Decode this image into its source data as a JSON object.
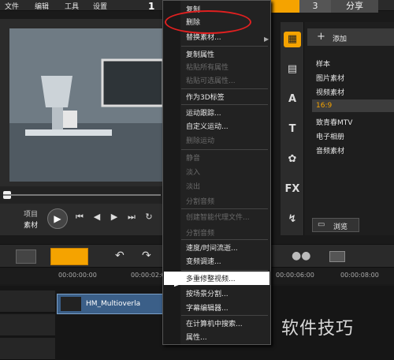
{
  "menubar": {
    "items": [
      "文件",
      "编辑",
      "工具",
      "设置"
    ]
  },
  "steps": {
    "step1": "1",
    "step3": "3",
    "share": "分享"
  },
  "player": {
    "project_label": "项目",
    "clip_label": "素材"
  },
  "library": {
    "add_label": "添加",
    "items": [
      "样本",
      "图片素材",
      "视频素材",
      "16:9",
      "致青春MTV",
      "电子相册",
      "音频素材"
    ],
    "browse_label": "浏览"
  },
  "ruler": {
    "times": [
      "00:00:00:00",
      "00:00:02:00",
      "00:00:06:00",
      "00:00:08:00"
    ]
  },
  "clip": {
    "name": "HM_Multioverla"
  },
  "context_menu": {
    "items": [
      {
        "label": "复制",
        "disabled": false
      },
      {
        "label": "删除",
        "disabled": false
      },
      {
        "label": "替换素材...",
        "disabled": false
      },
      {
        "label": "复制属性",
        "disabled": false
      },
      {
        "label": "粘贴所有属性",
        "disabled": true
      },
      {
        "label": "粘贴可选属性...",
        "disabled": true
      },
      {
        "label": "作为3D标签",
        "disabled": false
      },
      {
        "label": "运动跟踪...",
        "disabled": false
      },
      {
        "label": "自定义运动...",
        "disabled": false
      },
      {
        "label": "删除运动",
        "disabled": true
      },
      {
        "label": "静音",
        "disabled": true
      },
      {
        "label": "淡入",
        "disabled": true
      },
      {
        "label": "淡出",
        "disabled": true
      },
      {
        "label": "分割音频",
        "disabled": true
      },
      {
        "label": "创建智能代理文件...",
        "disabled": true
      },
      {
        "label": "分割音频",
        "disabled": true
      },
      {
        "label": "速度/时间流逝...",
        "disabled": false
      },
      {
        "label": "变频调速...",
        "disabled": false
      },
      {
        "label": "多重修整视频...",
        "disabled": false
      },
      {
        "label": "按场景分割...",
        "disabled": false
      },
      {
        "label": "字幕编辑器...",
        "disabled": false
      },
      {
        "label": "在计算机中搜索...",
        "disabled": false
      },
      {
        "label": "属性...",
        "disabled": false
      }
    ]
  },
  "watermark": "软件技巧",
  "colors": {
    "accent": "#f5a300",
    "highlight_oval": "#e02020"
  }
}
